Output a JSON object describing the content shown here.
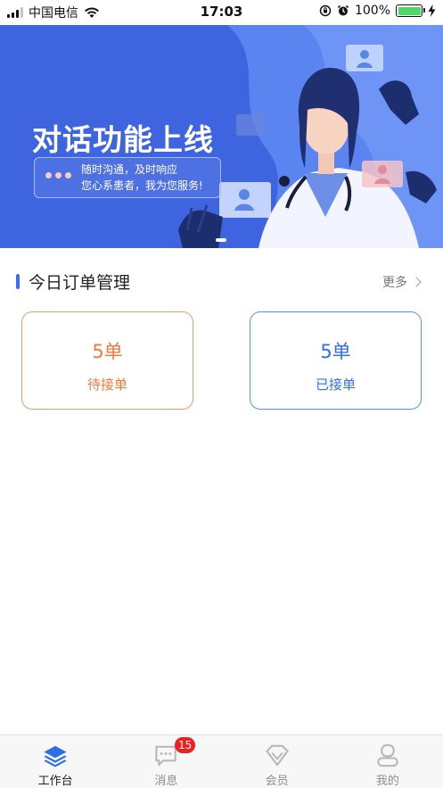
{
  "status_bar": {
    "carrier": "中国电信",
    "time": "17:03",
    "battery": "100%"
  },
  "banner": {
    "headline": "对话功能上线",
    "line1": "随时沟通，及时响应",
    "line2": "您心系患者，我为您服务!"
  },
  "orders": {
    "title": "今日订单管理",
    "more": "更多",
    "pending": {
      "count": "5单",
      "label": "待接单"
    },
    "accepted": {
      "count": "5单",
      "label": "已接单"
    }
  },
  "tabbar": {
    "tabs": [
      {
        "label": "工作台",
        "icon": "layers-icon",
        "active": true
      },
      {
        "label": "消息",
        "icon": "message-icon",
        "badge": "15"
      },
      {
        "label": "会员",
        "icon": "diamond-icon"
      },
      {
        "label": "我的",
        "icon": "person-icon"
      }
    ]
  },
  "colors": {
    "brand_blue": "#3e64e0",
    "accent_orange": "#f07a3c",
    "accent_blue": "#2f70e3",
    "badge_red": "#ee1f1f"
  }
}
